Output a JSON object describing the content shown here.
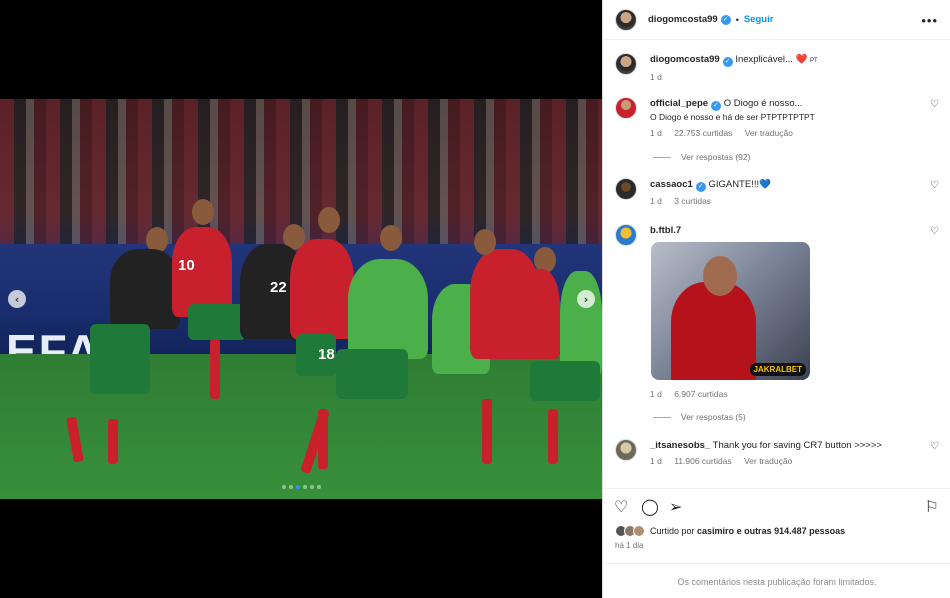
{
  "post": {
    "username": "diogomcosta99",
    "separator": "•",
    "follow_label": "Seguir",
    "more_icon": "more-horizontal-icon"
  },
  "caption": {
    "username": "diogomcosta99",
    "text": "Inexplicável... ❤️",
    "flag": "PT",
    "time": "1 d"
  },
  "photo": {
    "board_text": "EFA",
    "jersey_left": "10",
    "jersey_mid": "18",
    "jersey_keeper": "22",
    "slide_count": 6,
    "active_slide": 3
  },
  "comments": [
    {
      "username": "official_pepe",
      "text": "O Diogo é nosso...",
      "text2": "O Diogo é nosso e há de ser PTPTPTPTPT",
      "time": "1 d",
      "likes": "22.753 curtidas",
      "translate": "Ver tradução",
      "replies": "Ver respostas (92)"
    },
    {
      "username": "cassaoc1",
      "text": "GIGANTE!!!💙",
      "time": "1 d",
      "likes": "3 curtidas"
    },
    {
      "username": "b.ftbl.7",
      "gif_logo": "JAKRALBET",
      "time": "1 d",
      "likes": "6.907 curtidas",
      "replies": "Ver respostas (5)"
    },
    {
      "username": "_itsanesobs_",
      "text": "Thank you for saving CR7 button >>>>>",
      "time": "1 d",
      "likes": "11.906 curtidas",
      "translate": "Ver tradução"
    }
  ],
  "actions": {
    "liked_prefix": "Curtido por ",
    "liked_user": "casimiro",
    "liked_suffix": " e outras 914.487 pessoas",
    "time": "há 1 dia",
    "limited": "Os comentários nesta publicação foram limitados."
  },
  "colors": {
    "accent": "#0095f6",
    "verified": "#3897f0"
  }
}
